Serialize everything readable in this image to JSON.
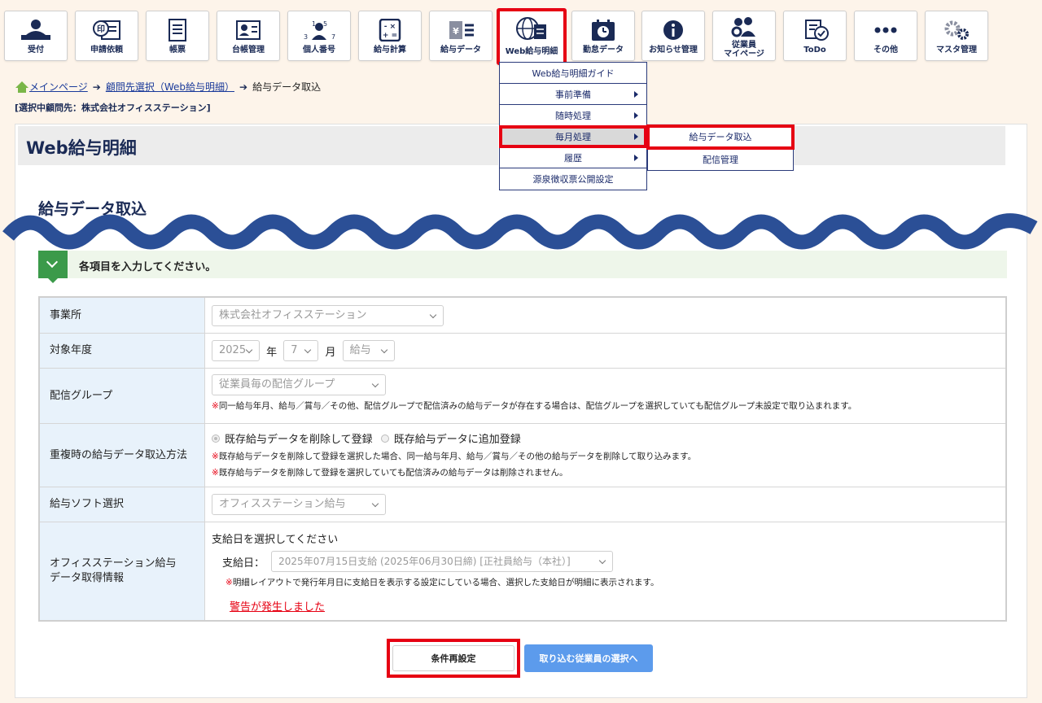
{
  "toolbar": {
    "items": [
      {
        "label": "受付"
      },
      {
        "label": "申請依頼"
      },
      {
        "label": "帳票"
      },
      {
        "label": "台帳管理"
      },
      {
        "label": "個人番号"
      },
      {
        "label": "給与計算"
      },
      {
        "label": "給与データ"
      },
      {
        "label": "Web給与明細"
      },
      {
        "label": "勤怠データ"
      },
      {
        "label": "お知らせ管理"
      },
      {
        "label_line1": "従業員",
        "label_line2": "マイページ"
      },
      {
        "label": "ToDo"
      },
      {
        "label": "その他"
      },
      {
        "label": "マスタ管理"
      }
    ]
  },
  "menu": {
    "items": [
      {
        "label": "Web給与明細ガイド"
      },
      {
        "label": "事前準備"
      },
      {
        "label": "随時処理"
      },
      {
        "label": "毎月処理"
      },
      {
        "label": "履歴"
      },
      {
        "label": "源泉徴収票公開設定"
      }
    ],
    "submenu": [
      {
        "label": "給与データ取込"
      },
      {
        "label": "配信管理"
      }
    ]
  },
  "breadcrumb": {
    "home": "メインページ",
    "client_select": "顧問先選択（Web給与明細）",
    "current": "給与データ取込"
  },
  "client_label": "[選択中顧問先：株式会社オフィスステーション]",
  "page_title": "Web給与明細",
  "section_title": "給与データ取込",
  "info": "各項目を入力してください。",
  "form": {
    "office": {
      "label": "事業所",
      "value": "株式会社オフィスステーション"
    },
    "year": {
      "label": "対象年度",
      "year": "2025",
      "year_unit": "年",
      "month": "7",
      "month_unit": "月",
      "type": "給与"
    },
    "group": {
      "label": "配信グループ",
      "value": "従業員毎の配信グループ",
      "note_mark": "※",
      "note": "同一給与年月、給与／賞与／その他、配信グループで配信済みの給与データが存在する場合は、配信グループを選択していても配信グループ未設定で取り込まれます。"
    },
    "duplicate": {
      "label": "重複時の給与データ取込方法",
      "option1": "既存給与データを削除して登録",
      "option2": "既存給与データに追加登録",
      "note_mark": "※",
      "note1": "既存給与データを削除して登録を選択した場合、同一給与年月、給与／賞与／その他の給与データを削除して取り込みます。",
      "note2": "既存給与データを削除して登録を選択していても配信済みの給与データは削除されません。"
    },
    "software": {
      "label": "給与ソフト選択",
      "value": "オフィスステーション給与"
    },
    "info_get": {
      "label_line1": "オフィスステーション給与",
      "label_line2": "データ取得情報",
      "prompt": "支給日を選択してください",
      "payday_label": "支給日：",
      "payday_value": "2025年07月15日支給 (2025年06月30日締) [正社員給与（本社）]",
      "note_mark": "※",
      "note": "明細レイアウトで発行年月日に支給日を表示する設定にしている場合、選択した支給日が明細に表示されます。",
      "warning": "警告が発生しました"
    }
  },
  "buttons": {
    "reset": "条件再設定",
    "next": "取り込む従業員の選択へ"
  },
  "colors": {
    "highlight": "#e60012",
    "primary": "#5c9bec",
    "navy": "#1a2a55"
  }
}
